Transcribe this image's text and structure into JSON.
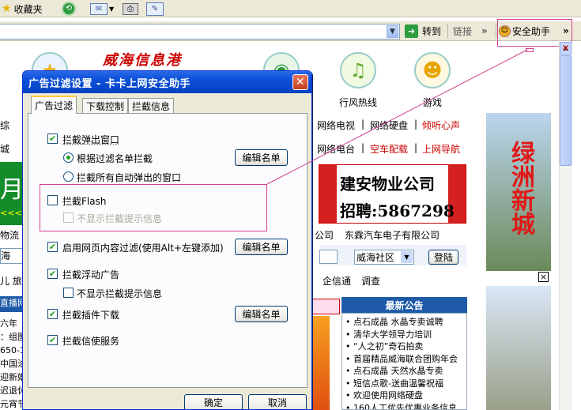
{
  "browser": {
    "favorites_label": "收藏夹",
    "goto_label": "转到",
    "links_label": "链接",
    "assistant_label": "安全助手",
    "more_glyph": "»"
  },
  "page": {
    "nav_icons": [
      "行风热线",
      "游戏"
    ],
    "logo_text": "威海信息港",
    "row1_links": [
      "网络电视",
      "网络硬盘",
      "倾听心声"
    ],
    "row2_links": [
      "网络电台",
      "空车配载",
      "上网导航"
    ],
    "left_row1": "综",
    "left_row2": "城",
    "left_green": "月",
    "left_arrows": "<<<",
    "left_row3": "物流",
    "company_a": "公司",
    "company_b": "东霖汽车电子有限公司",
    "form_left": "海",
    "community": "威海社区",
    "login_button": "登陆",
    "left_row4": "儿  旅",
    "enterprise": "企信通",
    "survey": "调查",
    "bluebar_text": "直播网",
    "ad1_line1": "建安物业公司",
    "ad1_line2": "招聘:5867298",
    "ad2_text": "绿洲新城",
    "close_x": "×",
    "notice_title": "最新公告",
    "notice_items": [
      "点石成晶 水晶专卖诚聘",
      "清华大学领导力培训",
      "“人之初”奇石拍卖",
      "首届精品威海联合团购年会",
      "点石成晶 天然水晶专卖",
      "短信点歌-送曲温馨祝福",
      "欢迎使用网络硬盘",
      "160人工优先优惠业务信息"
    ],
    "left_col": [
      "六年",
      "：组图",
      "650-1",
      "中国油",
      "迎新婚",
      "迟退休",
      "元宵节"
    ]
  },
  "dialog": {
    "title": "广告过滤设置 - 卡卡上网安全助手",
    "close_glyph": "✕",
    "tabs": [
      "广告过滤",
      "下载控制",
      "拦截信息"
    ],
    "options": {
      "block_popups": "拦截弹出窗口",
      "by_filter": "根据过滤名单拦截",
      "block_all_auto": "拦截所有自动弹出的窗口",
      "block_flash": "拦截Flash",
      "hide_flash_tip": "不显示拦截提示信息",
      "content_filter": "启用网页内容过滤(使用Alt+左键添加)",
      "block_floating": "拦截浮动广告",
      "hide_floating_tip": "不显示拦截提示信息",
      "block_plugin": "拦截插件下载",
      "block_messenger": "拦截信使服务"
    },
    "edit_list": "编辑名单",
    "ok": "确定",
    "cancel": "取消",
    "check_glyph": "✔"
  }
}
